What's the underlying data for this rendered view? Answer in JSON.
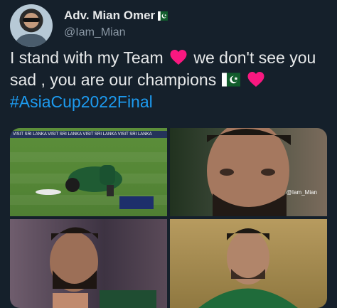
{
  "author": {
    "display_name": "Adv. Mian Omer",
    "handle": "@Iam_Mian"
  },
  "tweet": {
    "line1_a": "I stand with my Team",
    "line1_b": "we don't see you",
    "line2_a": "sad , you are our champions",
    "hashtag": "#AsiaCup2022Final"
  },
  "media": {
    "banner_text": "VISIT SRI LANKA  VISIT SRI LANKA  VISIT SRI LANKA  VISIT SRI LANKA",
    "watermark": "@Iam_Mian"
  },
  "colors": {
    "background": "#15202b",
    "text": "#e7e9ea",
    "secondary_text": "#8b98a5",
    "hashtag": "#1d9bf0",
    "heart": "#f91880"
  }
}
